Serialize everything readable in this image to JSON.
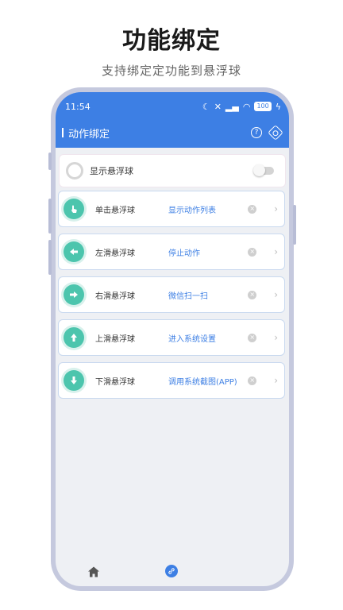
{
  "promo": {
    "title": "功能绑定",
    "subtitle": "支持绑定定功能到悬浮球"
  },
  "status_bar": {
    "time": "11:54",
    "battery": "100"
  },
  "toolbar": {
    "title": "动作绑定",
    "help_icon": "help-circle-icon",
    "settings_icon": "settings-icon"
  },
  "floating_ball": {
    "label": "显示悬浮球",
    "enabled": false
  },
  "bindings": [
    {
      "gesture": "单击悬浮球",
      "action": "显示动作列表",
      "icon": "tap-icon"
    },
    {
      "gesture": "左滑悬浮球",
      "action": "停止动作",
      "icon": "arrow-left-icon"
    },
    {
      "gesture": "右滑悬浮球",
      "action": "微信扫一扫",
      "icon": "arrow-right-icon"
    },
    {
      "gesture": "上滑悬浮球",
      "action": "进入系统设置",
      "icon": "arrow-up-icon"
    },
    {
      "gesture": "下滑悬浮球",
      "action": "调用系统截图(APP)",
      "icon": "arrow-down-icon"
    }
  ],
  "colors": {
    "accent": "#3d7fe4",
    "icon_teal": "#4cc5ad",
    "background": "#eef0f4"
  },
  "bottom_nav": {
    "home_icon": "home-icon",
    "bind_icon": "link-icon",
    "active": "bind"
  }
}
